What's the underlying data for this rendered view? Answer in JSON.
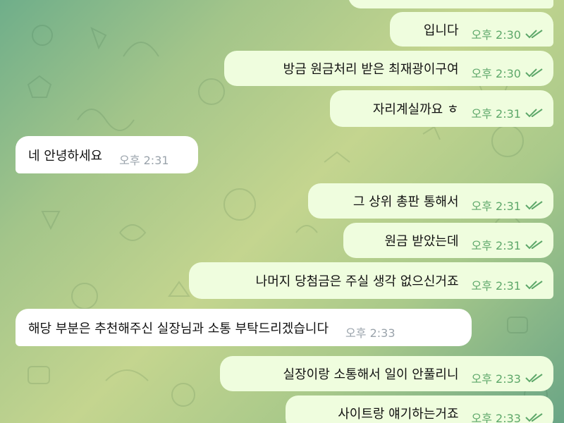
{
  "colors": {
    "outgoing_bubble": "#effdde",
    "incoming_bubble": "#ffffff",
    "outgoing_time": "#5ea86a",
    "incoming_time": "#9aa3ab",
    "read_check": "#5ea86a"
  },
  "messages": [
    {
      "direction": "out",
      "text": "입니다",
      "time": "오후 2:30",
      "status_icon": "double-check-icon"
    },
    {
      "direction": "out",
      "text": "방금 원금처리 받은 최재광이구여",
      "time": "오후 2:30",
      "status_icon": "double-check-icon"
    },
    {
      "direction": "out",
      "text": "자리계실까요 ㅎ",
      "time": "오후 2:31",
      "status_icon": "double-check-icon"
    },
    {
      "direction": "in",
      "text": "네 안녕하세요",
      "time": "오후 2:31"
    },
    {
      "direction": "out",
      "text": "그 상위 총판 통해서",
      "time": "오후 2:31",
      "status_icon": "double-check-icon"
    },
    {
      "direction": "out",
      "text": "원금 받았는데",
      "time": "오후 2:31",
      "status_icon": "double-check-icon"
    },
    {
      "direction": "out",
      "text": "나머지 당첨금은 주실 생각 없으신거죠",
      "time": "오후 2:31",
      "status_icon": "double-check-icon"
    },
    {
      "direction": "in",
      "text": "해당 부분은 추천해주신 실장님과 소통 부탁드리겠습니다",
      "time": "오후 2:33"
    },
    {
      "direction": "out",
      "text": "실장이랑 소통해서 일이 안풀리니",
      "time": "오후 2:33",
      "status_icon": "double-check-icon"
    },
    {
      "direction": "out",
      "text": "사이트랑 얘기하는거죠",
      "time": "오후 2:33",
      "status_icon": "double-check-icon"
    }
  ]
}
